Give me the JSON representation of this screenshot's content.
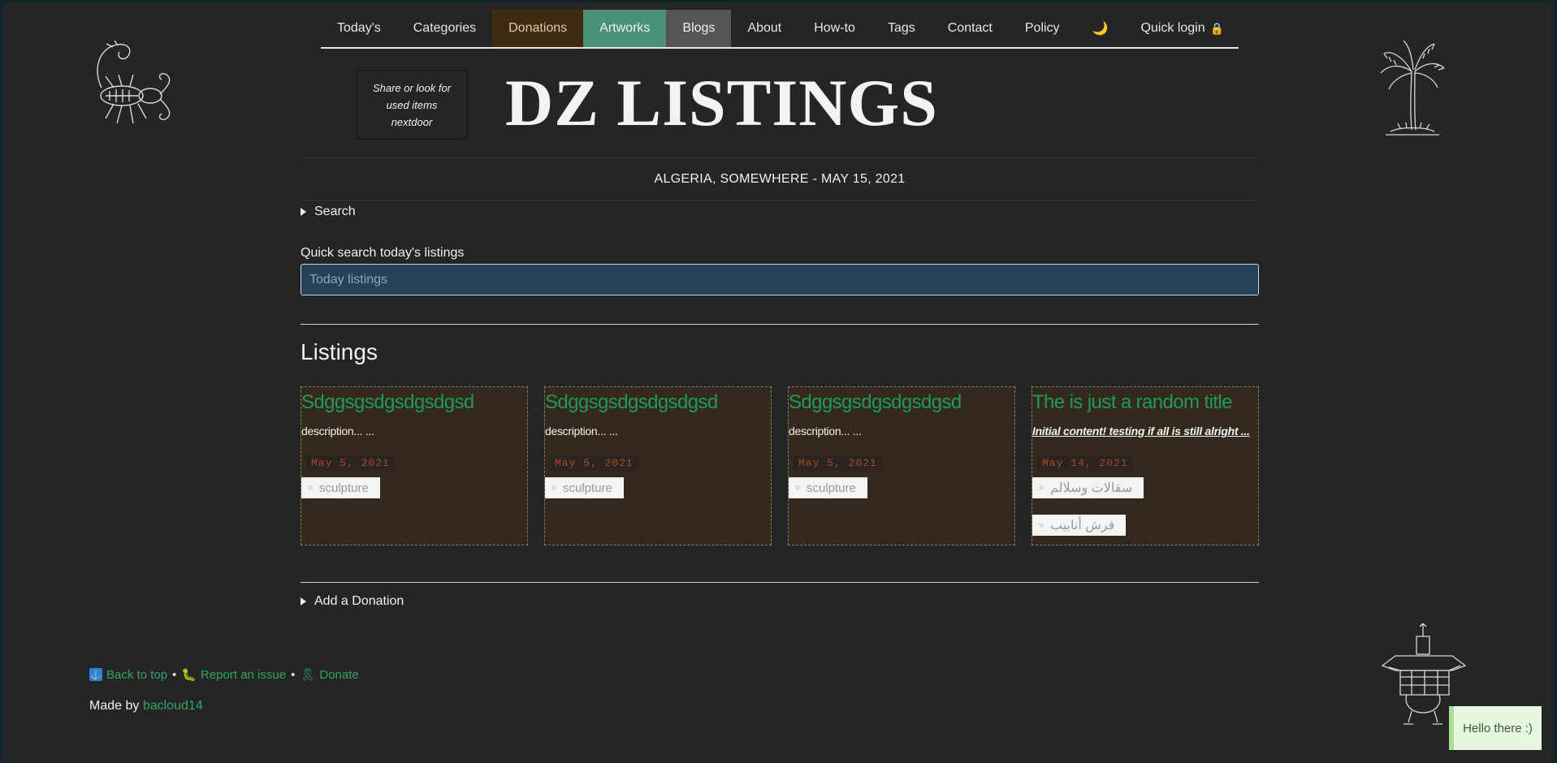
{
  "nav": {
    "items": [
      {
        "label": "Today's"
      },
      {
        "label": "Categories"
      },
      {
        "label": "Donations"
      },
      {
        "label": "Artworks"
      },
      {
        "label": "Blogs"
      },
      {
        "label": "About"
      },
      {
        "label": "How-to"
      },
      {
        "label": "Tags"
      },
      {
        "label": "Contact"
      },
      {
        "label": "Policy"
      }
    ],
    "theme_toggle": "🌙",
    "theme_icon": "moon-icon",
    "login_label": "Quick login",
    "login_icon": "lock-icon",
    "lock_glyph": "🔒"
  },
  "header": {
    "tagline": "Share or look for used items nextdoor",
    "title": "DZ LISTINGS",
    "dateline": "ALGERIA, SOMEWHERE - MAY 15, 2021"
  },
  "search": {
    "summary": "Search",
    "quick_label": "Quick search today's listings",
    "placeholder": "Today listings"
  },
  "listings": {
    "heading": "Listings",
    "cards": [
      {
        "title": "Sdggsgsdgsdgsdgsd",
        "description": "description... ...",
        "date": "May 5, 2021",
        "tags": [
          "sculpture"
        ]
      },
      {
        "title": "Sdggsgsdgsdgsdgsd",
        "description": "description... ...",
        "date": "May 5, 2021",
        "tags": [
          "sculpture"
        ]
      },
      {
        "title": "Sdggsgsdgsdgsdgsd",
        "description": "description... ...",
        "date": "May 5, 2021",
        "tags": [
          "sculpture"
        ]
      },
      {
        "title": "The is just a random title",
        "description": "Initial content! testing if all is still alright ...",
        "date": "May 14, 2021",
        "tags": [
          "سقالات وسلالم",
          "فرش أنابيب"
        ]
      }
    ]
  },
  "donation": {
    "summary": "Add a Donation"
  },
  "footer": {
    "back_to_top": "Back to top",
    "back_icon": "anchor-icon",
    "report": "Report an issue",
    "report_icon": "bug-icon",
    "donate": "Donate",
    "donate_icon": "ribbon-icon",
    "bullet": "•",
    "made_by": "Made by",
    "author": "bacloud14"
  },
  "toast": {
    "message": "Hello there :)"
  },
  "decorations": [
    "scorpion-drawing",
    "palm-tree-drawing",
    "camel-drawing"
  ],
  "colors": {
    "background": "#252525",
    "accent_green": "#1f9a57",
    "card_bg": "#33291f",
    "input_bg": "#264257",
    "date_text": "#b0452a"
  }
}
